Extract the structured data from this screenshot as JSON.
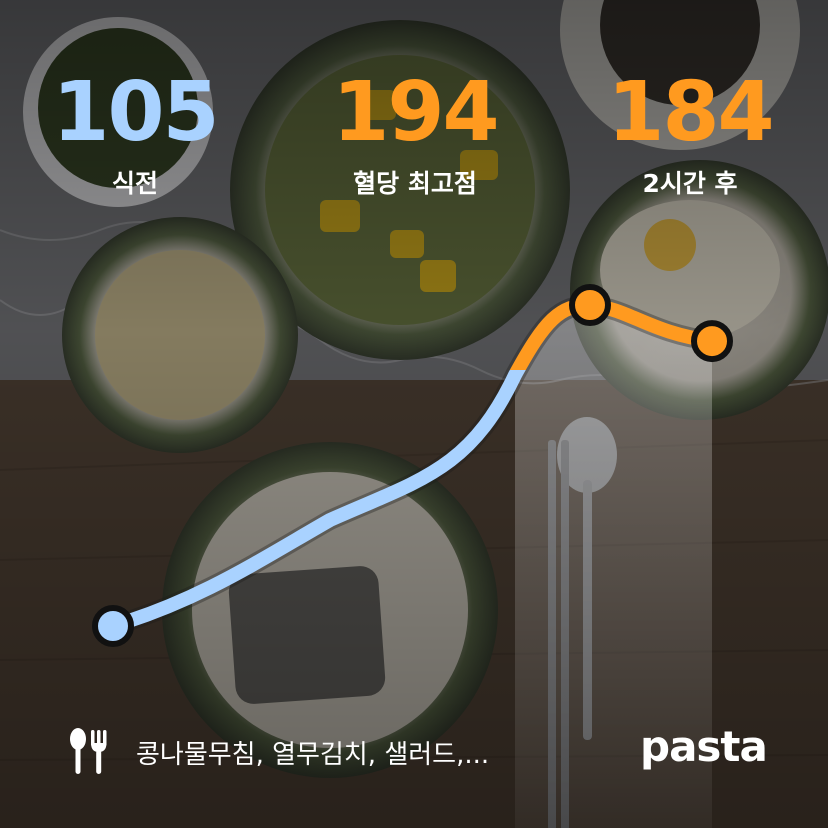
{
  "stats": [
    {
      "value": "105",
      "label": "식전",
      "color": "#a9d2ff"
    },
    {
      "value": "194",
      "label": "혈당 최고점",
      "color": "#ff9a1f"
    },
    {
      "value": "184",
      "label": "2시간 후",
      "color": "#ff9a1f"
    }
  ],
  "chart_data": {
    "type": "line",
    "x": [
      "식전",
      "혈당 최고점",
      "2시간 후"
    ],
    "series": [
      {
        "values": [
          105,
          194,
          184
        ]
      }
    ],
    "colors": {
      "below_threshold": "#a9d2ff",
      "above_threshold": "#ff9a1f"
    }
  },
  "meal": {
    "icon": "fork-knife-icon",
    "text": "콩나물무침, 열무김치, 샐러드,..."
  },
  "brand": {
    "name": "pasta"
  }
}
